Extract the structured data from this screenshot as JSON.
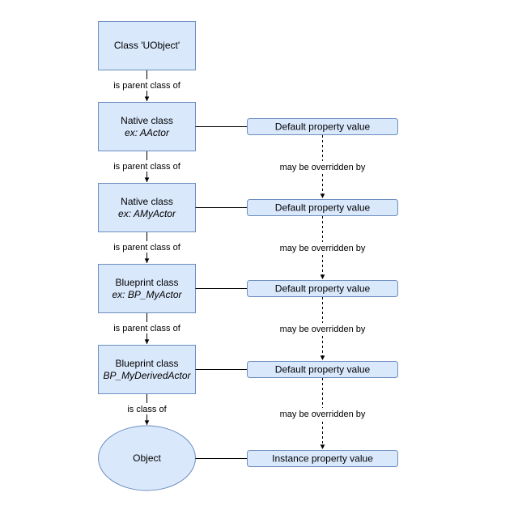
{
  "colors": {
    "fill": "#dae8fc",
    "stroke": "#6c8ebf",
    "line": "#000000"
  },
  "class_nodes": [
    {
      "id": "uobject",
      "title": "Class 'UObject'",
      "subtitle": ""
    },
    {
      "id": "native-aactor",
      "title": "Native class",
      "subtitle": "ex: AActor"
    },
    {
      "id": "native-amyactor",
      "title": "Native class",
      "subtitle": "ex: AMyActor"
    },
    {
      "id": "bp-myactor",
      "title": "Blueprint class",
      "subtitle": "ex: BP_MyActor"
    },
    {
      "id": "bp-myderivedactor",
      "title": "Blueprint class",
      "subtitle": "BP_MyDerivedActor"
    }
  ],
  "object_node": {
    "id": "object",
    "title": "Object"
  },
  "property_nodes": [
    {
      "label": "Default property value"
    },
    {
      "label": "Default property value"
    },
    {
      "label": "Default property value"
    },
    {
      "label": "Default property value"
    },
    {
      "label": "Instance property value"
    }
  ],
  "hierarchy_edges": [
    {
      "label": "is parent class of"
    },
    {
      "label": "is parent class of"
    },
    {
      "label": "is parent class of"
    },
    {
      "label": "is parent class of"
    },
    {
      "label": "is class of"
    }
  ],
  "override_edges": [
    {
      "label": "may be overridden by"
    },
    {
      "label": "may be overridden by"
    },
    {
      "label": "may be overridden by"
    },
    {
      "label": "may be overridden by"
    }
  ]
}
